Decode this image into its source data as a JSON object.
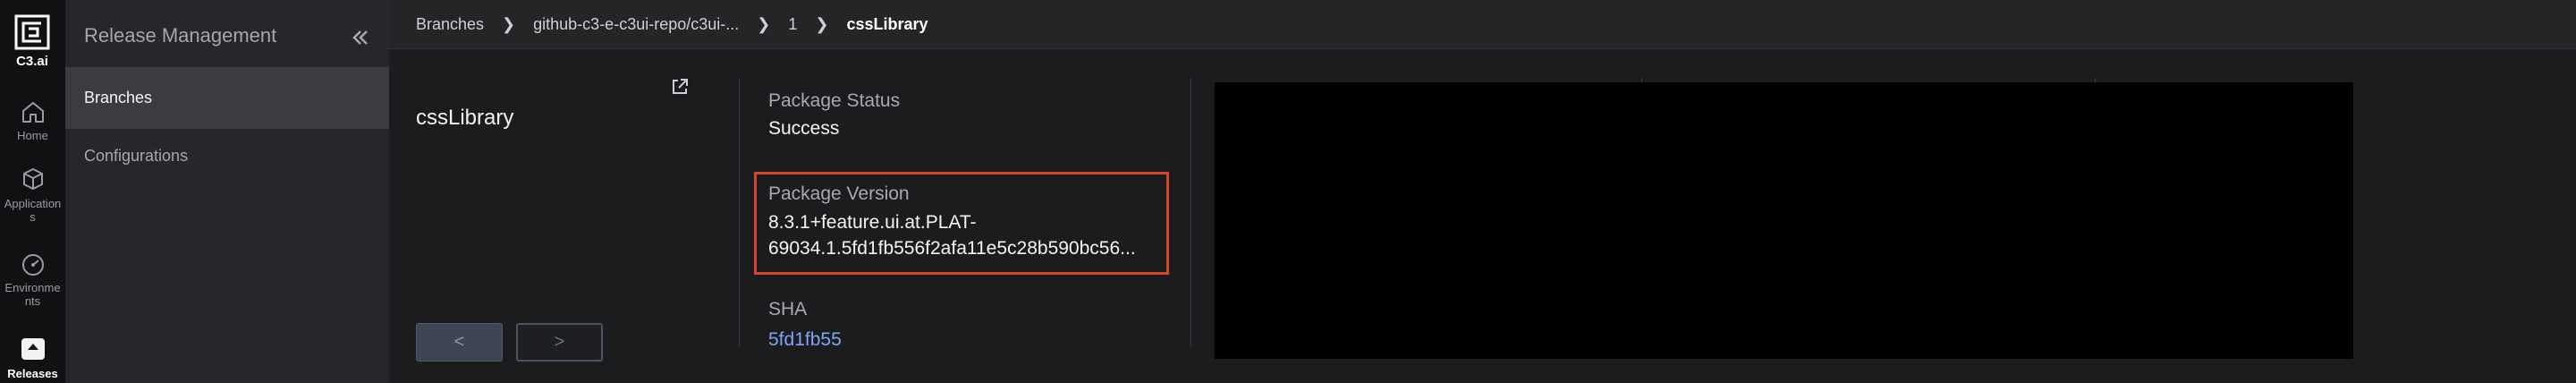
{
  "rail": {
    "logo_text": "C3.ai",
    "items": [
      {
        "label": "Home",
        "icon": "home-icon"
      },
      {
        "label": "Applications",
        "icon": "cube-icon"
      },
      {
        "label": "Environments",
        "icon": "gauge-icon"
      },
      {
        "label": "Releases",
        "icon": "releases-icon",
        "active": true
      }
    ]
  },
  "subnav": {
    "title": "Release Management",
    "items": [
      {
        "label": "Branches",
        "active": true
      },
      {
        "label": "Configurations",
        "active": false
      }
    ]
  },
  "breadcrumb": {
    "items": [
      "Branches",
      "github-c3-e-c3ui-repo/c3ui-...",
      "1",
      "cssLibrary"
    ]
  },
  "package": {
    "name": "cssLibrary",
    "status_label": "Package Status",
    "status_value": "Success",
    "version_label": "Package Version",
    "version_line1": "8.3.1+feature.ui.at.PLAT-",
    "version_line2": "69034.1.5fd1fb556f2afa11e5c28b590bc56...",
    "sha_label": "SHA",
    "sha_value": "5fd1fb55",
    "prev_label": "<",
    "next_label": ">"
  },
  "colors": {
    "highlight": "#d9452c",
    "link": "#7ea6f2"
  }
}
